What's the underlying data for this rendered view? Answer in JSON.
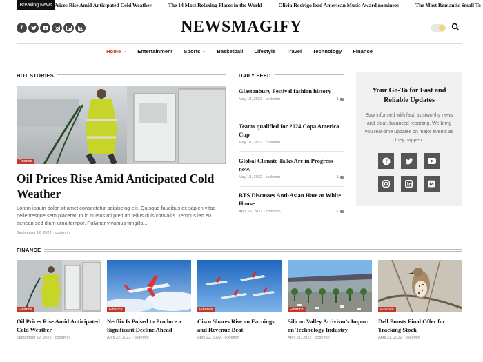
{
  "ticker": {
    "label": "Breaking News",
    "items": [
      "Oil Prices Rise Amid Anticipated Cold Weather",
      "The 14 Most Relaxing Places in the World",
      "Olivia Rodrigo lead American Music Award nominees",
      "The Most Romantic Small To"
    ]
  },
  "header": {
    "logo": "NEWSMAGIFY",
    "social": [
      "facebook-icon",
      "twitter-icon",
      "youtube-icon",
      "instagram-icon",
      "linkedin-icon",
      "medium-icon"
    ]
  },
  "nav": {
    "items": [
      "Home",
      "Entertainment",
      "Sports",
      "Basketball",
      "Lifestyle",
      "Travel",
      "Technology",
      "Finance"
    ]
  },
  "hot": {
    "heading": "HOT STORIES",
    "badge": "Finance",
    "title": "Oil Prices Rise Amid Anticipated Cold Weather",
    "excerpt": "Lorem ipsum dolor sit amet consectetur adipiscing elit. Quisque faucibus ex sapien vitae pellentesque sem placerat. In id cursus mi pretium tellus duis convallis. Tempus leo eu aenean sed diam urna tempor. Pulvinar vivamus fringilla...",
    "meta": "September 12, 2022 · codemin"
  },
  "feed": {
    "heading": "DAILY FEED",
    "items": [
      {
        "title": "Glastonbury Festival fashion history",
        "meta": "May 18, 2022 · codemin",
        "comments": "1"
      },
      {
        "title": "Teams qualified for 2024 Copa America Cup",
        "meta": "May 18, 2022 · codemin",
        "comments": ""
      },
      {
        "title": "Global Climate Talks Are in Progress now.",
        "meta": "May 18, 2022 · codemin",
        "comments": "1"
      },
      {
        "title": "BTS Discusses Anti-Asian Hate at White House",
        "meta": "April 22, 2022 · codemin",
        "comments": "1"
      }
    ]
  },
  "sidebar": {
    "title": "Your Go-To for Fast and Reliable Updates",
    "text": "Stay informed with fast, trustworthy news and clear, balanced reporting. We bring you real-time updates on major events  as they happen.",
    "icons": [
      "facebook-icon",
      "twitter-icon",
      "youtube-icon",
      "instagram-icon",
      "linkedin-icon",
      "medium-icon"
    ]
  },
  "finance": {
    "heading": "FINANCE",
    "cards": [
      {
        "badge": "Finance",
        "title": "Oil Prices Rise Amid Anticipated Cold Weather",
        "meta": "September 12, 2022 · codemin"
      },
      {
        "badge": "Finance",
        "title": "Netflix Is Poised to Produce a Significant Decline Ahead",
        "meta": "April 22, 2022 · codemin"
      },
      {
        "badge": "Finance",
        "title": "Cisco Shares Rise on Earnings and Revenue Beat",
        "meta": "April 22, 2022 · codemin"
      },
      {
        "badge": "Finance",
        "title": "Silicon Valley Activism’s Impact on Technology Industry",
        "meta": "April 21, 2022 · codemin"
      },
      {
        "badge": "Finance",
        "title": "Dell Boosts Final Offer for Tracking Stock",
        "meta": "April 21, 2022 · codemin"
      }
    ]
  },
  "colors": {
    "accent": "#c0392b",
    "dark": "#111111",
    "sidebar_bg": "#f0f0f0"
  }
}
